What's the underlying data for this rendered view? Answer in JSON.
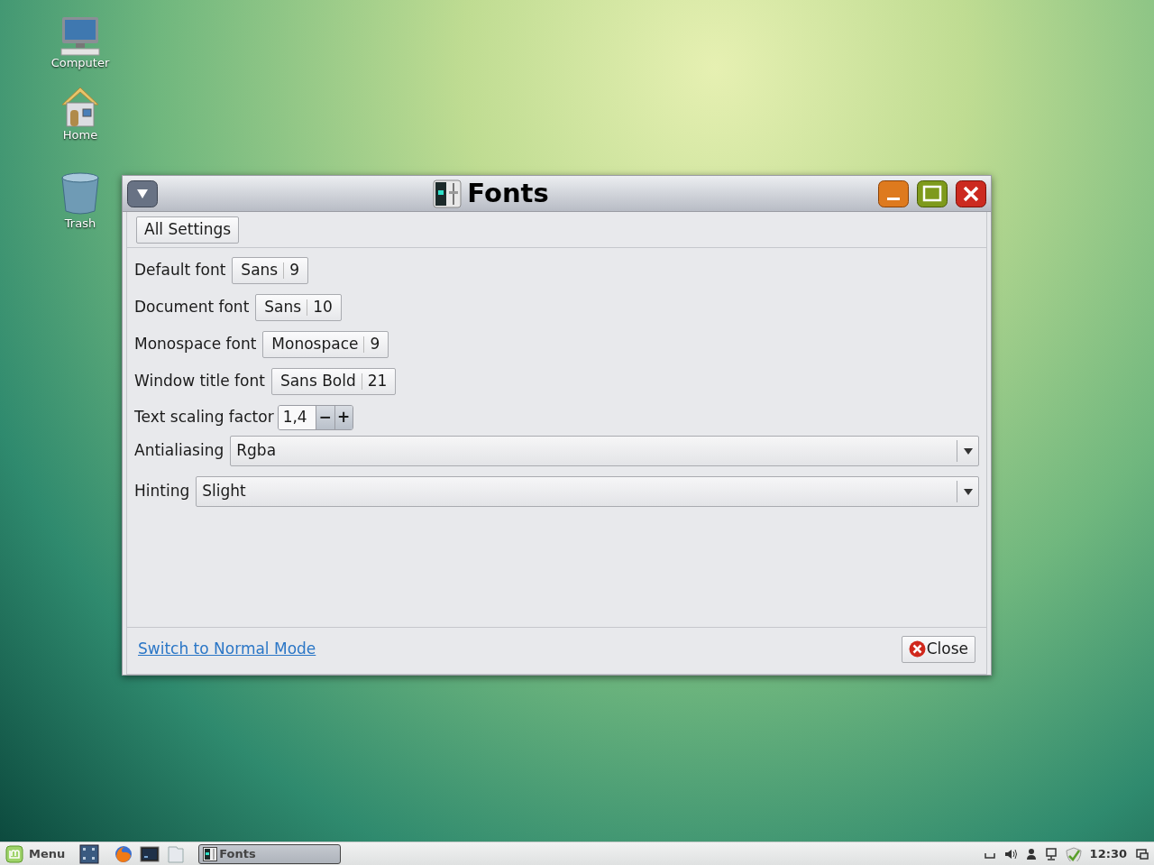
{
  "desktop_icons": [
    {
      "kind": "computer",
      "label": "Computer"
    },
    {
      "kind": "home",
      "label": "Home"
    },
    {
      "kind": "trash",
      "label": "Trash"
    }
  ],
  "window": {
    "title": "Fonts"
  },
  "toolbar": {
    "button": "All Settings"
  },
  "font_rows": [
    {
      "label": "Default font",
      "font": "Sans",
      "size": "9"
    },
    {
      "label": "Document font",
      "font": "Sans",
      "size": "10"
    },
    {
      "label": "Monospace font",
      "font": "Monospace",
      "size": "9"
    },
    {
      "label": "Window title font",
      "font": "Sans Bold",
      "size": "21"
    }
  ],
  "scaling": {
    "label": "Text scaling factor",
    "value": "1,4",
    "decrement": "−",
    "increment": "+"
  },
  "dropdowns": [
    {
      "label": "Antialiasing",
      "value": "Rgba"
    },
    {
      "label": "Hinting",
      "value": "Slight"
    }
  ],
  "footer": {
    "link": "Switch to Normal Mode",
    "close_button": "Close"
  },
  "taskbar": {
    "menu": "Menu",
    "launchers": [
      {
        "kind": "workspace"
      },
      {
        "kind": "browser"
      },
      {
        "kind": "terminal"
      },
      {
        "kind": "files"
      }
    ],
    "windows": [
      {
        "label": "Fonts",
        "selected": true
      }
    ],
    "tray": [
      {
        "kind": "keyboard"
      },
      {
        "kind": "volume"
      },
      {
        "kind": "user"
      },
      {
        "kind": "network"
      },
      {
        "kind": "shield"
      }
    ],
    "clock": "12:30"
  }
}
